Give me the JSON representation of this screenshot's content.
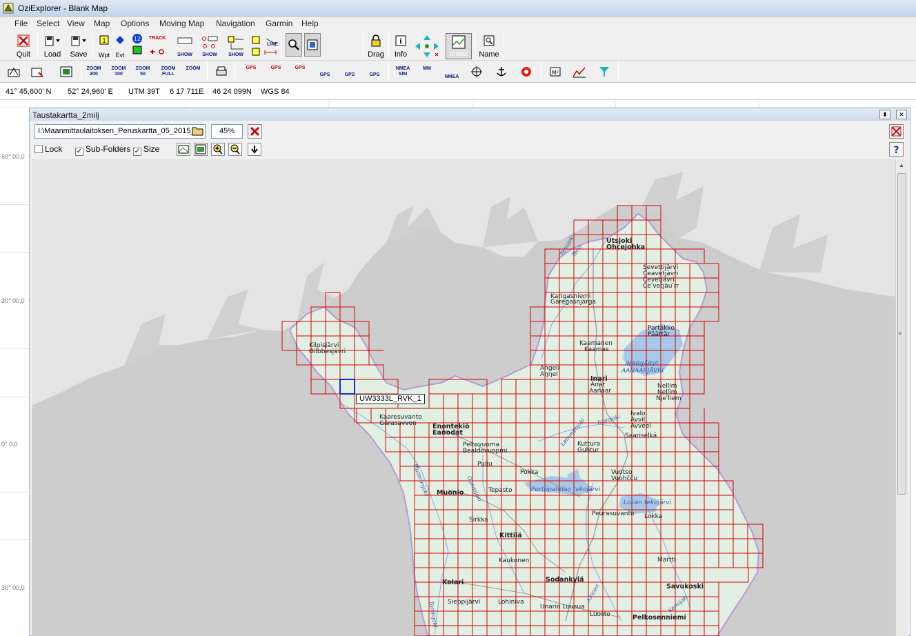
{
  "window": {
    "title": "OziExplorer - Blank Map"
  },
  "menu": [
    "File",
    "Select",
    "View",
    "Map",
    "Options",
    "Moving Map",
    "Navigation",
    "Garmin",
    "Help"
  ],
  "toolbar": {
    "quit": "Quit",
    "load": "Load",
    "save": "Save",
    "wpt": "Wpt",
    "evt": "Evt",
    "track_small": "TRACK",
    "show1": "SHOW",
    "show2": "SHOW",
    "show3": "SHOW",
    "line": "LINE",
    "zoom_value": "100",
    "drag": "Drag",
    "info": "Info",
    "index": "Index",
    "name": "Name"
  },
  "toolbar2": {
    "zoom200": "ZOOM\n200",
    "zoom100": "ZOOM\n100",
    "zoom50": "ZOOM\n50",
    "zoomfull": "ZOOM\nFULL",
    "zoom_rect": "ZOOM",
    "gps1": "GPS",
    "gps2": "GPS",
    "gps3": "GPS",
    "gps4": "GPS",
    "gps5": "GPS",
    "gps6": "GPS",
    "nmea_sim": "NMEA\nSIM",
    "mm": "MM",
    "nmea": "NMEA"
  },
  "status": {
    "lat": "41° 45,600' N",
    "lon": "52° 24,960' E",
    "utm": "UTM  39T",
    "easting": "6 17 711E",
    "northing": "46 24 099N",
    "datum": "WGS 84"
  },
  "background_lat_labels": [
    "60° 00,0",
    "30° 00,0",
    "0° 0,0",
    "30° 00,0"
  ],
  "map_index": {
    "title": "Taustakartta_2milj",
    "path": "I:\\Maanmittaulaitoksen_Peruskartta_05_2015_",
    "zoom_percent": "45%",
    "lock_label": "Lock",
    "subfolders_label": "Sub-Folders",
    "size_label": "Size",
    "lock_checked": false,
    "subfolders_checked": true,
    "size_checked": true,
    "tooltip": "UW3333L_RVK_1"
  },
  "place_names": {
    "utsjoki": "Utsjoki",
    "ohcejohka": "Ohcejohka",
    "sevettijarvi1": "Sevettijärvi",
    "sevettijarvi2": "Čeavetjávri",
    "sevettijarvi3": "Čevetjävri",
    "sevettijarvi4": "Čeʹvetjäuʹrr",
    "karigasniemi": "Karigasniemi",
    "garegasnjarga": "Gáregasnjárga",
    "partakko": "Partakko",
    "paadar": "Päättär",
    "kaamanen": "Kaamanen",
    "kaamas": "Kaamas",
    "inarijarvi": "INARIJÄRVI",
    "aanaarjavri": "AANAARJÄVRI",
    "angeli": "Angeli",
    "anggel": "Aŋŋel",
    "inari": "Inari",
    "anar": "Anár",
    "aanaar": "Aanaar",
    "nellim1": "Nellim",
    "nellim2": "Nellim",
    "nellim3": "Njeʹllem",
    "ivalo": "Ivalo",
    "avvil": "Avvil",
    "avveel": "Avveel",
    "saariselka": "Saariselkä",
    "kilpisjarvi": "Kilpisjärvi",
    "gilbbesjavri": "Gilbbesjávri",
    "karesuvanto": "Kaaresuvanto",
    "gaaresavvon": "Gárasavvon",
    "enontekio": "Enontekiö",
    "eanodat": "Eanodat",
    "peltovuoma": "Peltovuoma",
    "bealdovuopmi": "Bealdovuopmi",
    "pulju": "Pulju",
    "kuttura": "Kuttura",
    "guhtur": "Guhtur",
    "pokka": "Pokka",
    "vuotso": "Vuotso",
    "vuohccu": "Vuohčču",
    "muonio": "Muonio",
    "tepasto": "Tepasto",
    "porttipahta": "Porttipahdan tekojärvi",
    "lokka_lake": "Lokan tekojärvi",
    "peurasuvanto": "Peurasuvanto",
    "lokka": "Lokka",
    "sirkka": "Sirkka",
    "kittila": "Kittilä",
    "kaukonen": "Kaukonen",
    "martti": "Martti",
    "kolari": "Kolari",
    "sodankyla": "Sodankylä",
    "savukoski": "Savukoski",
    "sieppijarvi": "Sieppijärvi",
    "lohiniva": "Lohiniva",
    "unarin_luusua": "Unarin Luusua",
    "luosto": "Luosto",
    "pelkosenniemi": "Pelkosenniemi",
    "tenojoki": "Tenojoki",
    "teno": "Teno",
    "ivalojoki": "Ivalojoki",
    "lemmenjoki": "Lemmenjoki",
    "ounasjoki": "Ounasjoki",
    "kitinen": "Kitinen",
    "torniojoki": "Torniojoki",
    "muonionjoki": "Muonionjoki",
    "kemijoki": "Kemijoki"
  },
  "colors": {
    "land_bg": "#cdcdcd",
    "finland_fill": "#e2efe3",
    "grid": "#d40000",
    "selected_tile": "#1a2ad0",
    "water": "#a8c8e8",
    "norway_land": "#e4e4e4",
    "border": "#b79ad6"
  }
}
